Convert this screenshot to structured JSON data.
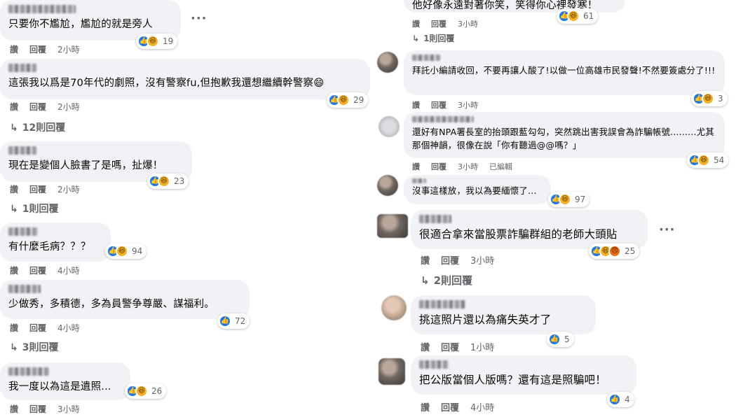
{
  "labels": {
    "like": "讚",
    "reply": "回覆"
  },
  "left": [
    {
      "text": "只要你不尷尬，尷尬的就是旁人",
      "time": "2小時",
      "reactions": [
        "like",
        "haha"
      ],
      "count": "19",
      "replies": ""
    },
    {
      "text": "這張我以爲是70年代的劇照，沒有警察fu,但抱歉我還想繼續幹警察😄",
      "time": "2小時",
      "reactions": [
        "like",
        "haha"
      ],
      "count": "29",
      "replies": "12則回覆"
    },
    {
      "text": "現在是變個人臉書了是嗎，扯爆！",
      "time": "2小時",
      "reactions": [
        "like",
        "haha"
      ],
      "count": "23",
      "replies": "1則回覆"
    },
    {
      "text": "有什麼毛病？？？",
      "time": "4小時",
      "reactions": [
        "like",
        "haha"
      ],
      "count": "94",
      "replies": ""
    },
    {
      "text": "少做秀，多積德，多為員警争尊嚴、謀福利。",
      "time": "4小時",
      "reactions": [
        "like"
      ],
      "count": "72",
      "replies": "3則回覆"
    },
    {
      "text": "我一度以為這是遺照...",
      "time": "3小時",
      "reactions": [
        "like",
        "haha"
      ],
      "count": "26",
      "replies": ""
    }
  ],
  "right": [
    {
      "text": "他好像永遠對著你笑，笑得你心裡發寒！",
      "time": "3小時",
      "reactions": [
        "like",
        "haha"
      ],
      "count": "61",
      "replies": "1則回覆",
      "edited": ""
    },
    {
      "text": "拜託小編請收回，不要再讓人酸了!以做一位高雄市民發聲!不然要簽處分了!!!",
      "time": "3小時",
      "reactions": [
        "like",
        "haha"
      ],
      "count": "3",
      "replies": "",
      "edited": ""
    },
    {
      "text": "還好有NPA署長室的抬頭跟藍勾勾，突然跳出害我誤會為詐騙帳號.........尤其那個神韻，很像在說「你有聽過@@嗎？」",
      "time": "3小時",
      "reactions": [
        "like",
        "haha"
      ],
      "count": "54",
      "replies": "",
      "edited": "已編輯"
    },
    {
      "text": "沒事這樣放，我以為要緬懷了...",
      "time": "",
      "reactions": [
        "like",
        "haha"
      ],
      "count": "97",
      "replies": "",
      "edited": ""
    },
    {
      "text": "很適合拿來當股票詐騙群組的老師大頭貼",
      "time": "3小時",
      "reactions": [
        "like",
        "haha",
        "angry"
      ],
      "count": "25",
      "replies": "2則回覆",
      "edited": ""
    },
    {
      "text": "挑這照片還以為痛失英才了",
      "time": "1小時",
      "reactions": [
        "like"
      ],
      "count": "5",
      "replies": "",
      "edited": ""
    },
    {
      "text": "把公版當個人版嗎？還有這是照騙吧！",
      "time": "4小時",
      "reactions": [
        "like"
      ],
      "count": "4",
      "replies": "",
      "edited": ""
    }
  ]
}
